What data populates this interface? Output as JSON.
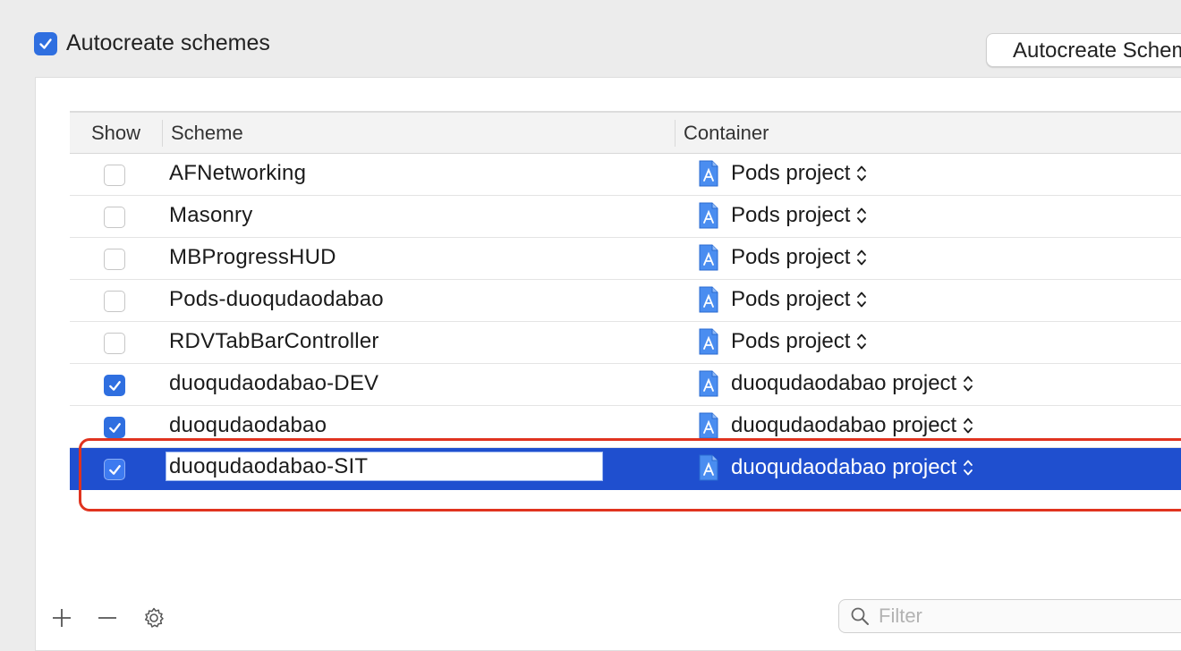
{
  "header": {
    "autocreate_checked": true,
    "autocreate_label": "Autocreate schemes",
    "autocreate_button": "Autocreate Schemes Now"
  },
  "table": {
    "columns": {
      "show": "Show",
      "scheme": "Scheme",
      "container": "Container"
    },
    "rows": [
      {
        "show": false,
        "scheme": "AFNetworking",
        "container": "Pods project",
        "selected": false
      },
      {
        "show": false,
        "scheme": "Masonry",
        "container": "Pods project",
        "selected": false
      },
      {
        "show": false,
        "scheme": "MBProgressHUD",
        "container": "Pods project",
        "selected": false
      },
      {
        "show": false,
        "scheme": "Pods-duoqudaodabao",
        "container": "Pods project",
        "selected": false
      },
      {
        "show": false,
        "scheme": "RDVTabBarController",
        "container": "Pods project",
        "selected": false
      },
      {
        "show": true,
        "scheme": "duoqudaodabao-DEV",
        "container": "duoqudaodabao project",
        "selected": false
      },
      {
        "show": true,
        "scheme": "duoqudaodabao",
        "container": "duoqudaodabao project",
        "selected": false
      },
      {
        "show": true,
        "scheme": "duoqudaodabao-SIT",
        "container": "duoqudaodabao project",
        "selected": true,
        "editing": true
      }
    ]
  },
  "footer": {
    "add_icon": "plus-icon",
    "remove_icon": "minus-icon",
    "settings_icon": "gear-icon",
    "filter_placeholder": "Filter"
  },
  "colors": {
    "accent": "#2f6fe0",
    "selection": "#1f4fcf",
    "annotation": "#e0331f"
  }
}
